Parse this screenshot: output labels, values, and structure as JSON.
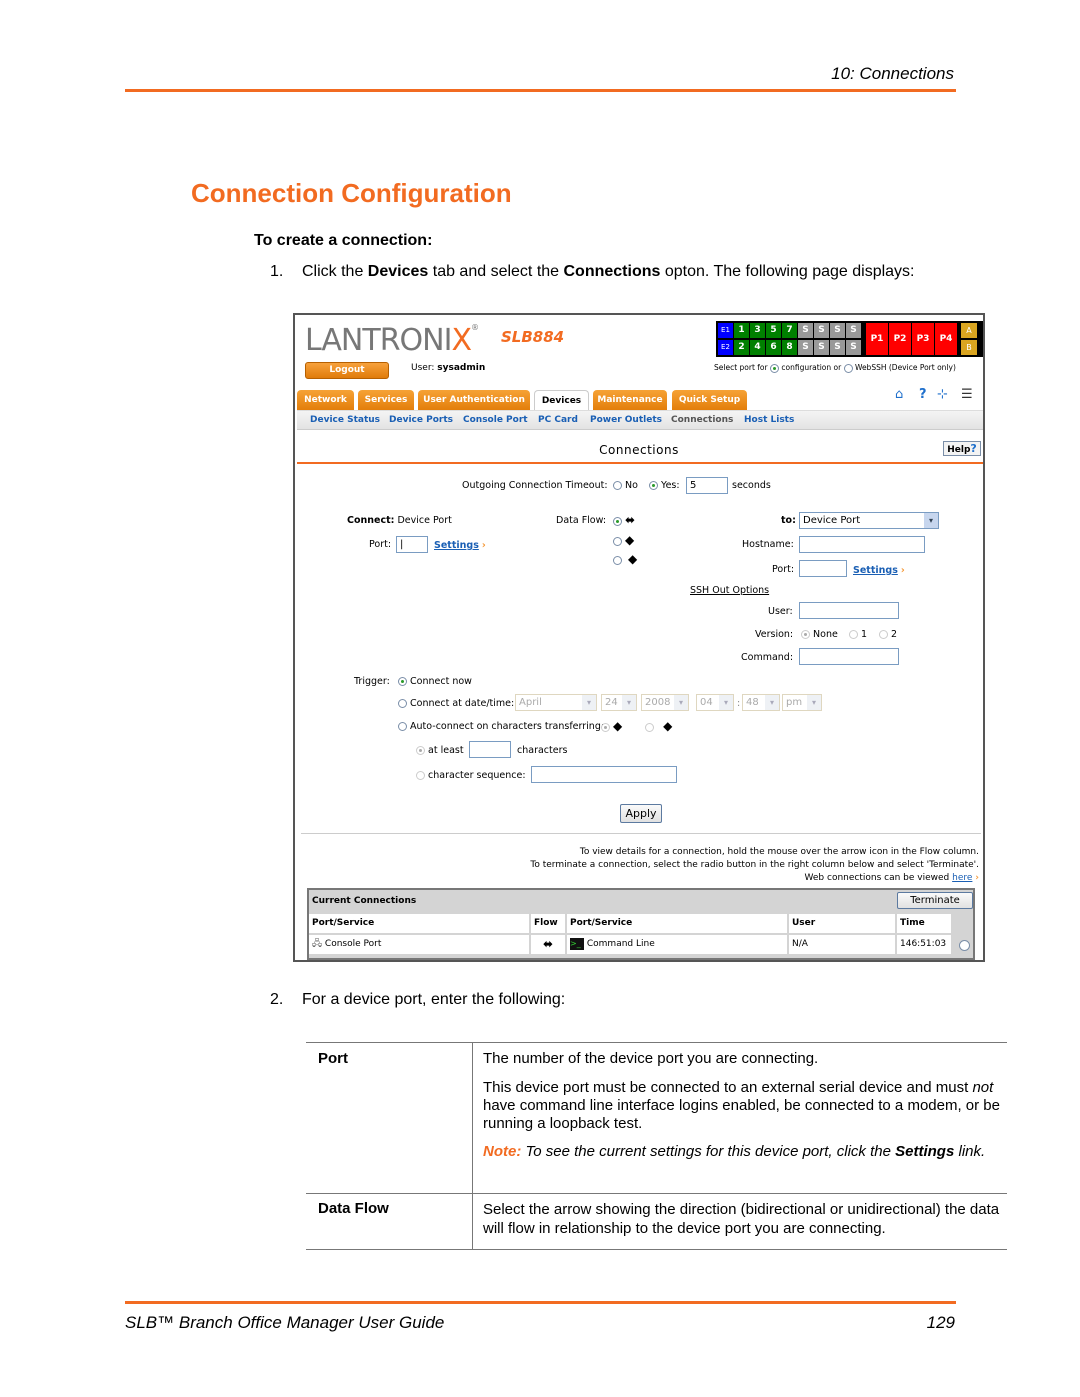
{
  "header": {
    "chapter": "10: Connections"
  },
  "section_title": "Connection Configuration",
  "procedure_title": "To create a connection:",
  "steps": [
    {
      "num": "1.",
      "parts": [
        "Click the ",
        "Devices",
        " tab and select the ",
        "Connections",
        " opton. The following page displays:"
      ]
    },
    {
      "num": "2.",
      "text": "For a device port, enter the following:"
    }
  ],
  "screenshot": {
    "logo": "LANTRONIX",
    "model": "SLB884",
    "logout_label": "Logout",
    "user_label": "User:",
    "user_name": "sysadmin",
    "port_grid": {
      "row1": [
        "E1",
        "1",
        "3",
        "5",
        "7",
        "S",
        "S",
        "S",
        "S"
      ],
      "row2": [
        "E2",
        "2",
        "4",
        "6",
        "8",
        "S",
        "S",
        "S",
        "S"
      ],
      "power": [
        "P1",
        "P2",
        "P3",
        "P4"
      ],
      "ab": [
        "A",
        "B"
      ],
      "colors": {
        "ethernet": "#0000ff",
        "device_port": "#008000",
        "spare": "#999999",
        "power": "#ff0000",
        "ab": "#daa520"
      }
    },
    "port_select": {
      "prefix": "Select port for",
      "opt1": "configuration or",
      "opt2": "WebSSH (Device Port only)"
    },
    "tabs": [
      "Network",
      "Services",
      "User Authentication",
      "Devices",
      "Maintenance",
      "Quick Setup"
    ],
    "active_tab": "Devices",
    "toolbar_icons": [
      "home-icon",
      "help-icon",
      "sitemap-icon",
      "menu-icon"
    ],
    "subnav": [
      "Device Status",
      "Device Ports",
      "Console Port",
      "PC Card",
      "Power Outlets",
      "Connections",
      "Host Lists"
    ],
    "active_subnav": "Connections",
    "page_title": "Connections",
    "help_label": "Help",
    "timeout": {
      "label": "Outgoing Connection Timeout:",
      "no": "No",
      "yes": "Yes:",
      "value": "5",
      "unit": "seconds",
      "selected": "yes"
    },
    "connect": {
      "label": "Connect:",
      "value": "Device Port",
      "port_label": "Port:",
      "port_value": "",
      "settings": "Settings"
    },
    "data_flow": {
      "label": "Data Flow:",
      "options": [
        "bidirectional",
        "left",
        "right"
      ],
      "selected": "bidirectional"
    },
    "to": {
      "label": "to:",
      "selected": "Device Port",
      "hostname_label": "Hostname:",
      "port_label": "Port:",
      "settings": "Settings",
      "ssh_header": "SSH Out Options",
      "user_label": "User:",
      "version_label": "Version:",
      "version_options": [
        "None",
        "1",
        "2"
      ],
      "version_selected": "None",
      "command_label": "Command:"
    },
    "trigger": {
      "label": "Trigger:",
      "now": "Connect now",
      "at": "Connect at date/time:",
      "month": "April",
      "day": "24",
      "year": "2008",
      "hour": "04",
      "minute": "48",
      "ampm": "pm",
      "auto": "Auto-connect on characters transferring:",
      "at_least": "at least",
      "characters": "characters",
      "sequence": "character sequence:",
      "selected": "now"
    },
    "apply_label": "Apply",
    "notes": [
      "To view details for a connection, hold the mouse over the arrow icon in the Flow column.",
      "To terminate a connection, select the radio button in the right column below and select 'Terminate'.",
      "Web connections can be viewed"
    ],
    "here_link": "here",
    "current_connections": {
      "title": "Current Connections",
      "terminate_label": "Terminate",
      "columns": [
        "Port/Service",
        "Flow",
        "Port/Service",
        "User",
        "Time"
      ],
      "rows": [
        {
          "from": "Console Port",
          "flow": "bidirectional",
          "to": "Command Line",
          "user": "N/A",
          "time": "146:51:03"
        }
      ]
    }
  },
  "table": {
    "rows": [
      {
        "term": "Port",
        "paras": [
          "The number of the device port you are connecting."
        ],
        "para2_parts": [
          "This device port must be connected to an external serial device and must ",
          "not",
          " have command line interface logins enabled, be connected to a modem, or be running a loopback test."
        ],
        "note_label": "Note:",
        "note_parts": [
          " To see the current settings for this device port, click the ",
          "Settings",
          " link."
        ]
      },
      {
        "term": "Data Flow",
        "paras": [
          "Select the arrow showing the direction (bidirectional or unidirectional) the data will flow in relationship to the device port you are connecting."
        ]
      }
    ]
  },
  "footer": {
    "title": "SLB™ Branch Office Manager User Guide",
    "page": "129"
  },
  "colors": {
    "accent": "#f26b21",
    "link": "#1a5fb4"
  }
}
